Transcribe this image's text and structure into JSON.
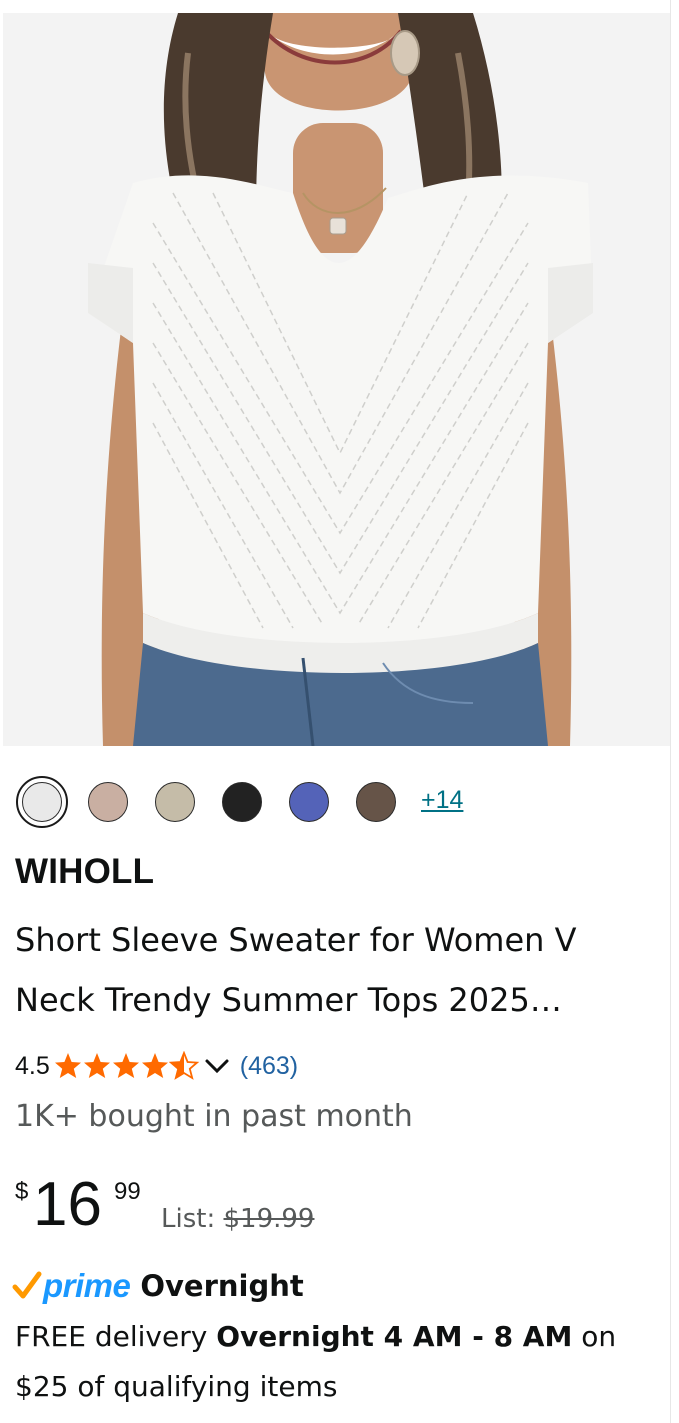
{
  "product": {
    "image_alt": "Woman wearing white short sleeve V neck sweater",
    "swatches": [
      {
        "name": "white",
        "color": "#e9e9e9",
        "selected": true
      },
      {
        "name": "beige-pink",
        "color": "#c9afa2"
      },
      {
        "name": "khaki",
        "color": "#c5bca8"
      },
      {
        "name": "black",
        "color": "#222222"
      },
      {
        "name": "blue",
        "color": "#5463b8"
      },
      {
        "name": "brown",
        "color": "#665448"
      }
    ],
    "more_colors": "+14",
    "brand": "WIHOLL",
    "title_line1": "Short Sleeve Sweater for Women V",
    "title_line2": "Neck Trendy Summer Tops 2025…",
    "rating": "4.5",
    "stars_filled": 4.5,
    "review_count": "(463)",
    "bought": "1K+ bought in past month",
    "price": {
      "symbol": "$",
      "whole": "16",
      "fraction": "99",
      "list_label": "List:",
      "list_price": "$19.99"
    },
    "prime": {
      "word": "prime",
      "speed": "Overnight"
    },
    "delivery": {
      "prefix": "FREE delivery",
      "window": "Overnight 4 AM - 8 AM",
      "suffix": "on $25 of qualifying items"
    }
  },
  "colors": {
    "link": "#007185",
    "review_link": "#2162a1",
    "star": "#ff6a00",
    "prime_blue": "#1a98ff",
    "prime_check": "#ff9900",
    "muted": "#565959"
  }
}
